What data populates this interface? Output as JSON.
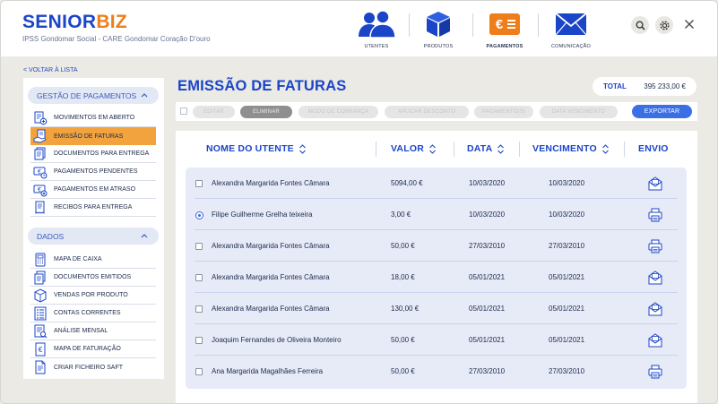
{
  "brand": {
    "part1": "SENIOR",
    "part2": "BIZ",
    "subtitle": "IPSS Gondomar Social - CARE Gondomar Coração D'ouro"
  },
  "nav": [
    {
      "label": "UTENTES",
      "icon": "users-icon"
    },
    {
      "label": "PRODUTOS",
      "icon": "box-icon"
    },
    {
      "label": "PAGAMENTOS",
      "icon": "euro-payments-icon"
    },
    {
      "label": "COMUNICAÇÃO",
      "icon": "envelope-icon"
    }
  ],
  "back_link": "< VOLTAR À LISTA",
  "sidebar": {
    "payments_header": "GESTÃO DE PAGAMENTOS",
    "payments_items": [
      {
        "label": "MOVIMENTOS EM ABERTO",
        "icon": "document-plus-icon"
      },
      {
        "label": "EMISSÃO DE FATURAS",
        "icon": "invoice-hand-icon"
      },
      {
        "label": "DOCUMENTOS PARA ENTREGA",
        "icon": "documents-icon"
      },
      {
        "label": "PAGAMENTOS PENDENTES",
        "icon": "pending-payment-icon"
      },
      {
        "label": "PAGAMENTOS EM ATRASO",
        "icon": "late-payment-icon"
      },
      {
        "label": "RECIBOS PARA ENTREGA",
        "icon": "receipt-icon"
      }
    ],
    "data_header": "DADOS",
    "data_items": [
      {
        "label": "MAPA DE CAIXA",
        "icon": "cash-map-icon"
      },
      {
        "label": "DOCUMENTOS EMITIDOS",
        "icon": "issued-documents-icon"
      },
      {
        "label": "VENDAS POR PRODUTO",
        "icon": "product-box-icon"
      },
      {
        "label": "CONTAS CORRENTES",
        "icon": "accounts-icon"
      },
      {
        "label": "ANÁLISE MENSAL",
        "icon": "analysis-icon"
      },
      {
        "label": "MAPA DE FATURAÇÃO",
        "icon": "billing-map-icon"
      },
      {
        "label": "CRIAR FICHEIRO SAFT",
        "icon": "saft-file-icon"
      }
    ]
  },
  "page_title": "EMISSÃO DE FATURAS",
  "total": {
    "label": "TOTAL",
    "value": "395 233,00 €"
  },
  "toolbar": {
    "edit": "EDITAR",
    "delete": "ELIMINAR",
    "charge_mode": "MODO DE COBRANÇA",
    "discount": "APLICAR DESCONTO",
    "installment": "PAGAMENTO(S)",
    "due_date": "DATA VENCIMENTO",
    "export": "EXPORTAR"
  },
  "table": {
    "headers": {
      "name": "NOME DO UTENTE",
      "value": "VALOR",
      "date": "DATA",
      "due": "VENCIMENTO",
      "send": "ENVIO"
    },
    "rows": [
      {
        "name": "Alexandra Margarida Fontes Câmara",
        "value": "5094,00 €",
        "date": "10/03/2020",
        "due": "10/03/2020",
        "send": "email",
        "selected": false
      },
      {
        "name": "Filipe Guilherme Grelha teixeira",
        "value": "3,00 €",
        "date": "10/03/2020",
        "due": "10/03/2020",
        "send": "print",
        "selected": true
      },
      {
        "name": "Alexandra Margarida Fontes Câmara",
        "value": "50,00 €",
        "date": "27/03/2010",
        "due": "27/03/2010",
        "send": "print",
        "selected": false
      },
      {
        "name": "Alexandra Margarida Fontes Câmara",
        "value": "18,00 €",
        "date": "05/01/2021",
        "due": "05/01/2021",
        "send": "email",
        "selected": false
      },
      {
        "name": "Alexandra Margarida Fontes Câmara",
        "value": "130,00 €",
        "date": "05/01/2021",
        "due": "05/01/2021",
        "send": "email",
        "selected": false
      },
      {
        "name": "Joaquim Fernandes de Oliveira Monteiro",
        "value": "50,00 €",
        "date": "05/01/2021",
        "due": "05/01/2021",
        "send": "email",
        "selected": false
      },
      {
        "name": "Ana Margarida Magalhães Ferreira",
        "value": "50,00 €",
        "date": "27/03/2010",
        "due": "27/03/2010",
        "send": "print",
        "selected": false
      }
    ]
  },
  "colors": {
    "brand_blue": "#1a45c9",
    "brand_orange": "#ee7d1a",
    "active_menu": "#f3a33e",
    "export_button": "#3a6fe6"
  }
}
